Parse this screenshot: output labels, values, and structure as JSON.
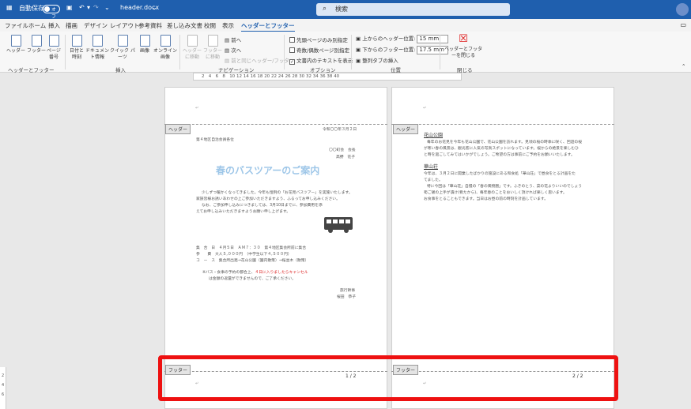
{
  "titlebar": {
    "autosave_label": "自動保存",
    "autosave_state": "オフ",
    "filename": "header.docx",
    "search_placeholder": "検索"
  },
  "menubar": {
    "items": [
      "ファイル",
      "ホーム",
      "挿入",
      "描画",
      "デザイン",
      "レイアウト",
      "参考資料",
      "差し込み文書",
      "校閲",
      "表示",
      "ヘッダーとフッター"
    ],
    "active_index": 10
  },
  "ribbon": {
    "groups": [
      {
        "label": "ヘッダーとフッター",
        "buttons": [
          "ヘッダー",
          "フッター",
          "ページ番号"
        ]
      },
      {
        "label": "挿入",
        "buttons": [
          "日付と時刻",
          "ドキュメント情報",
          "クイック パーツ",
          "画像",
          "オンライン画像"
        ]
      },
      {
        "label": "ナビゲーション",
        "buttons": [
          "ヘッダーに移動",
          "フッターに移動"
        ],
        "small": [
          "前へ",
          "次へ",
          "前と同じヘッダー/フッター"
        ]
      },
      {
        "label": "オプション",
        "checks": [
          {
            "label": "先頭ページのみ別指定",
            "checked": false
          },
          {
            "label": "奇数/偶数ページ別指定",
            "checked": false
          },
          {
            "label": "文書内のテキストを表示",
            "checked": true
          }
        ]
      },
      {
        "label": "位置",
        "fields": [
          {
            "label": "上からのヘッダー位置:",
            "value": "15 mm"
          },
          {
            "label": "下からのフッター位置:",
            "value": "17.5 mm"
          }
        ],
        "small": [
          "整列タブの挿入"
        ]
      },
      {
        "label": "閉じる",
        "buttons": [
          "ヘッダーとフッターを閉じる"
        ]
      }
    ]
  },
  "ruler": {
    "ticks": [
      "2",
      "4",
      "6",
      "8",
      "10",
      "12",
      "14",
      "16",
      "18",
      "20",
      "22",
      "24",
      "26",
      "28",
      "30",
      "32",
      "34",
      "36",
      "38",
      "40"
    ]
  },
  "vruler": {
    "ticks": [
      "2",
      "4",
      "6"
    ]
  },
  "page1": {
    "header_tag": "ヘッダー",
    "footer_tag": "フッター",
    "date": "令和〇〇年３月２日",
    "to": "第４地区自治会員各位",
    "from1": "〇〇町会　会長",
    "from2": "高野　花子",
    "title": "春のバスツアーのご案内",
    "body1": "少しずつ暖かくなってきました。今年も恒例の「お花見バスツアー」を実施いたします。",
    "body2": "家族皆様お誘いあわせの上ご参加いただきますよう、ふるってお申し込みください。",
    "body3": "なお、ご参加申し込みにつきましては、3月10日までに",
    "body3b": "、参加費用を添",
    "body4": "えてお申し込みいただきますようお願い申し上げます。",
    "detail1": "集　合　日　４月５日　ＡＭ７：３０　第４地区集会所前に集合",
    "detail2": "参　　費　大人５,０００円　（中学生以下４,５００円）",
    "detail3": "コ　ー　ス　集合所出発→花山公園（園内散策）→桜並木（散策）",
    "note1": "※バス・食事の予約の都合上、",
    "note1red": "４日に入りましたらキャンセル",
    "note1b": "は金額の返還ができませんので、ご了承ください。",
    "sign1": "旅行幹事",
    "sign2": "桜田　恭子",
    "page_num": "1 / 2"
  },
  "page2": {
    "header_tag": "ヘッダー",
    "footer_tag": "フッター",
    "h1": "花山公園",
    "p1": "毎年のお花見を今年も花山公園で、花山公園を訪れます。見頃の桜の時季に咲く、回遊の桜",
    "p2": "が寒い春の風景は、観光客に人気の写真スポットになっています。桜からの絶景を楽しむひ",
    "p3": "と時を過ごしてみてはいかがでしょう。ご希望の方は事前にご予約をお願いいたします。",
    "h2": "華山荘",
    "p4": "今年は、３月２日に開業したばかりの施設にある和食処「華山荘」で昼食をとる計画をた",
    "p5": "てました。",
    "p6": "特に今回は「華山荘」自慢の「春の風物膳」です。ふきのとう、菜の花よりいいのでしょう",
    "p7": "筍ご飯の上手が漬け(肴たから)、毎年春のことをおいしく頂ければ楽しく思います。",
    "p8": "お食事をとることもできます。当日はお昼の前の時刻を計画しています。",
    "page_num": "2 / 2"
  }
}
